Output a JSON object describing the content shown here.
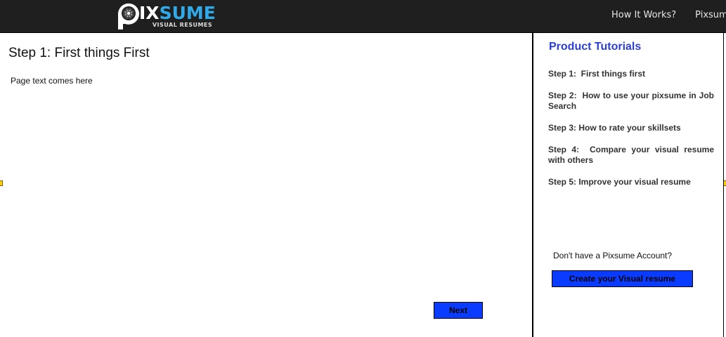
{
  "header": {
    "logo": {
      "icon": "camera-lens-icon",
      "wordmark_first": "IX",
      "wordmark_second": "SUME",
      "tagline": "VISUAL RESUMES"
    },
    "nav": [
      {
        "label": "How It Works?"
      },
      {
        "label": "Pixsume"
      }
    ]
  },
  "main": {
    "title": "Step 1: First things First",
    "body_text": "Page text comes here",
    "next_label": "Next"
  },
  "sidebar": {
    "title": "Product Tutorials",
    "items": [
      {
        "label": "Step 1:  First things first"
      },
      {
        "label": "Step 2:  How to use your pixsume in Job Search"
      },
      {
        "label": "Step 3: How to rate your skillsets"
      },
      {
        "label": "Step 4:  Compare your visual resume with others"
      },
      {
        "label": "Step 5: Improve your visual resume"
      }
    ],
    "account_prompt": "Don't have a Pixsume Account?",
    "create_label": "Create your Visual resume"
  },
  "colors": {
    "header_bg": "#1f1f1f",
    "logo_accent": "#2fa9e8",
    "sidebar_title": "#2b3fd6",
    "button_bg": "#0a3cff",
    "handle": "#ffd000"
  }
}
